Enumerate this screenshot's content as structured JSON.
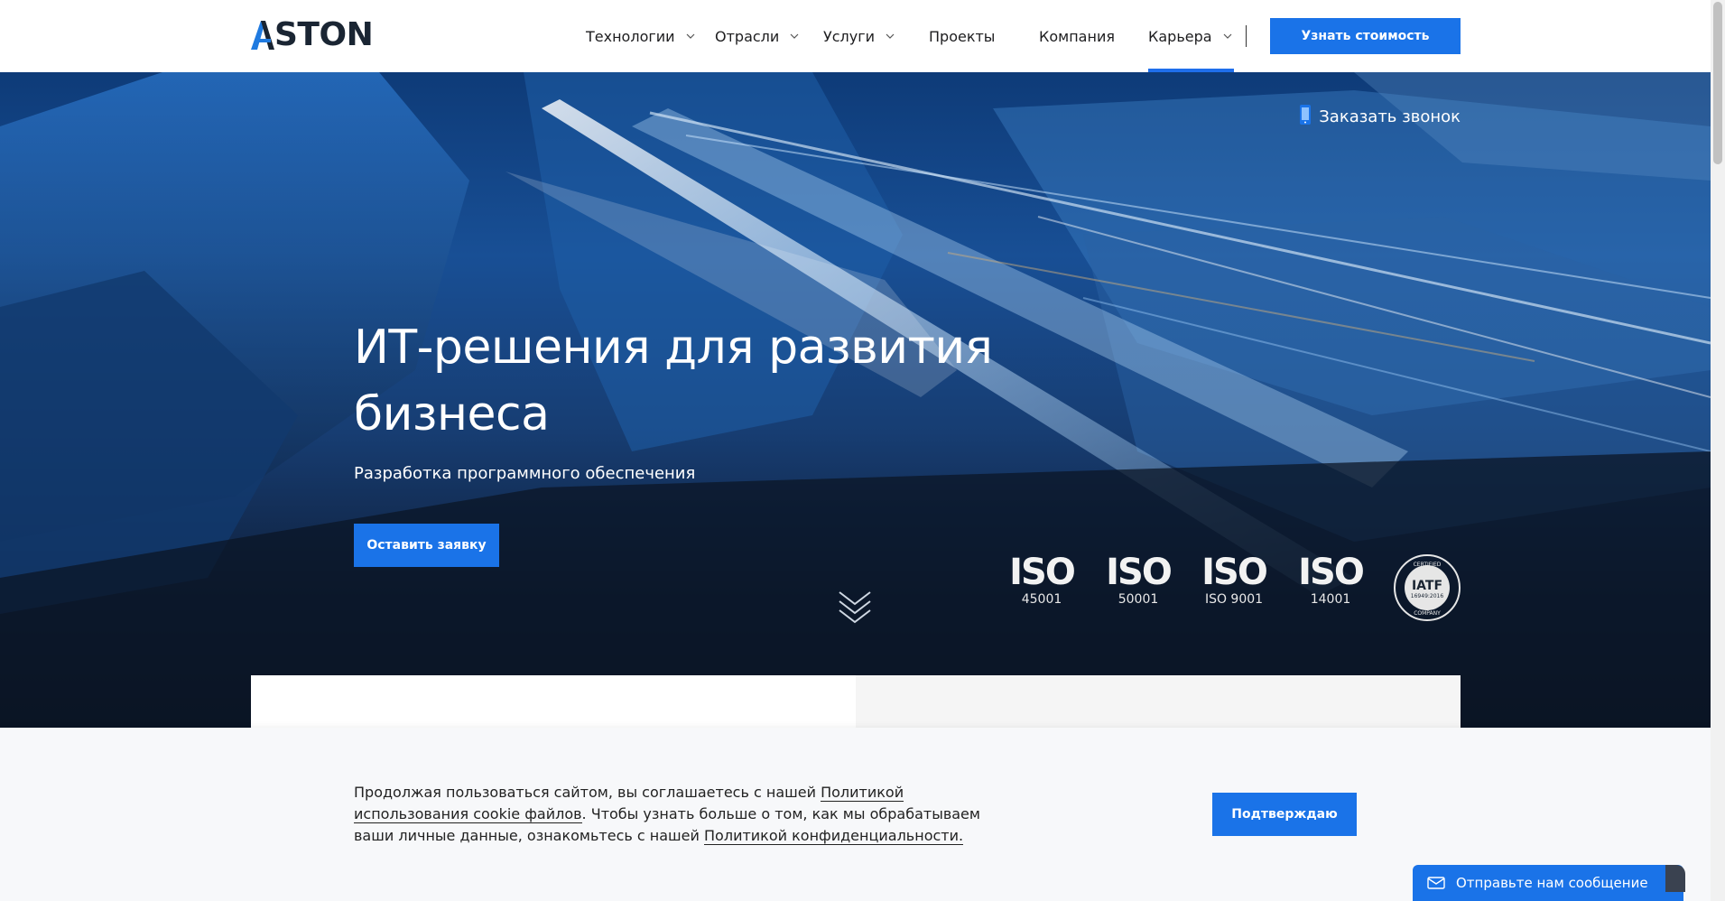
{
  "header": {
    "logo": "ASTON",
    "nav": [
      {
        "label": "Технологии",
        "dropdown": true
      },
      {
        "label": "Отрасли",
        "dropdown": true
      },
      {
        "label": "Услуги",
        "dropdown": true
      },
      {
        "label": "Проекты",
        "dropdown": false
      },
      {
        "label": "Компания",
        "dropdown": false
      },
      {
        "label": "Карьера",
        "dropdown": true,
        "active": true
      }
    ],
    "price_button": "Узнать стоимость"
  },
  "hero": {
    "callback": "Заказать звонок",
    "title": "ИТ-решения для развития бизнеса",
    "subtitle": "Разработка программного обеспечения",
    "apply_button": "Оставить заявку",
    "certs": [
      {
        "word": "ISO",
        "number": "45001"
      },
      {
        "word": "ISO",
        "number": "50001"
      },
      {
        "word": "ISO",
        "number": "ISO 9001"
      },
      {
        "word": "ISO",
        "number": "14001"
      }
    ],
    "iatf": {
      "top": "CERTIFIED",
      "main": "IATF",
      "num": "16949:2016",
      "bottom": "COMPANY"
    }
  },
  "cookie": {
    "text_1": "Продолжая пользоваться сайтом, вы соглашаетесь с нашей ",
    "link_1": "Политикой использования cookie файлов",
    "text_2": ". Чтобы узнать больше о том, как мы обрабатываем ваши личные данные, ознакомьтесь с нашей ",
    "link_2": "Политикой конфиденциальности.",
    "confirm_button": "Подтверждаю"
  },
  "chat": {
    "label": "Отправьте нам сообщение"
  },
  "colors": {
    "accent": "#1a73e8"
  }
}
